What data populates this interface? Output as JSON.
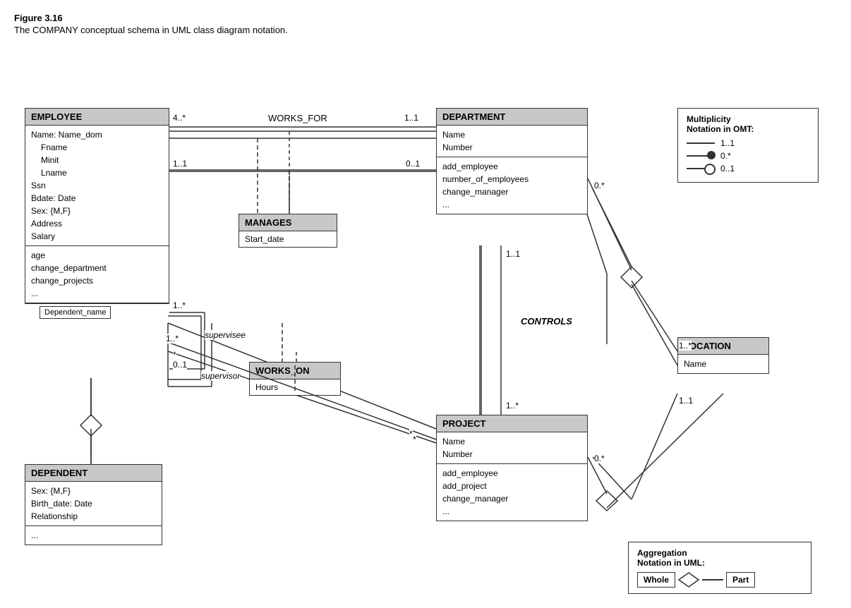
{
  "figure": {
    "title": "Figure 3.16",
    "caption": "The COMPANY conceptual schema in UML class diagram notation."
  },
  "classes": {
    "employee": {
      "header": "EMPLOYEE",
      "attributes": [
        "Name: Name_dom",
        "Fname",
        "Minit",
        "Lname",
        "Ssn",
        "Bdate: Date",
        "Sex: {M,F}",
        "Address",
        "Salary"
      ],
      "methods": [
        "age",
        "change_department",
        "change_projects",
        "..."
      ],
      "attribute_qualifier": "Dependent_name"
    },
    "department": {
      "header": "DEPARTMENT",
      "attributes": [
        "Name",
        "Number"
      ],
      "methods": [
        "add_employee",
        "number_of_employees",
        "change_manager",
        "..."
      ]
    },
    "project": {
      "header": "PROJECT",
      "attributes": [
        "Name",
        "Number"
      ],
      "methods": [
        "add_employee",
        "add_project",
        "change_manager",
        "..."
      ]
    },
    "dependent": {
      "header": "DEPENDENT",
      "attributes": [
        "Sex: {M,F}",
        "Birth_date: Date",
        "Relationship"
      ],
      "methods": [
        "..."
      ]
    },
    "location": {
      "header": "LOCATION",
      "attributes": [
        "Name"
      ],
      "methods": []
    }
  },
  "assoc_classes": {
    "manages": {
      "header": "MANAGES",
      "attributes": [
        "Start_date"
      ]
    },
    "works_on": {
      "header": "WORKS_ON",
      "attributes": [
        "Hours"
      ]
    }
  },
  "associations": {
    "works_for": "WORKS_FOR",
    "controls": "CONTROLS"
  },
  "multiplicities": {
    "works_for_emp": "4..*",
    "works_for_dep": "1..1",
    "manages_emp": "1..1",
    "manages_dep": "0..1",
    "supervises_supervisee": "*",
    "supervises_sup_label": "supervisee",
    "supervises_supervisor": "0..1",
    "supervises_supervisor_label": "supervisor",
    "works_on_emp": "1..*",
    "works_on_proj": "*",
    "controls_dep": "1..1",
    "controls_proj": "1..*",
    "location_dep": "0.*",
    "location_loc": "1..*",
    "location_loc2": "1..1",
    "project_aggr": "0.*"
  },
  "notation": {
    "title_line1": "Multiplicity",
    "title_line2": "Notation in OMT:",
    "rows": [
      {
        "label": "1..1"
      },
      {
        "label": "0.*"
      },
      {
        "label": "0..1"
      }
    ]
  },
  "aggregation": {
    "title_line1": "Aggregation",
    "title_line2": "Notation in UML:",
    "whole_label": "Whole",
    "part_label": "Part"
  }
}
